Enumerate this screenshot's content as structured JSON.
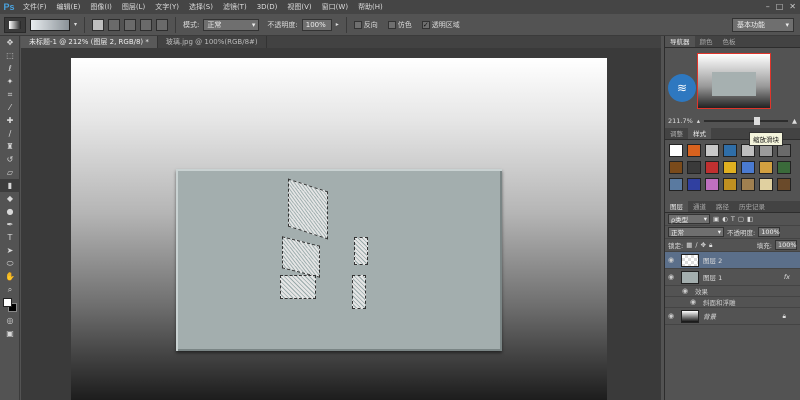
{
  "app": {
    "logo": "Ps",
    "menu": [
      "文件(F)",
      "编辑(E)",
      "图像(I)",
      "图层(L)",
      "文字(Y)",
      "选择(S)",
      "滤镜(T)",
      "3D(D)",
      "视图(V)",
      "窗口(W)",
      "帮助(H)"
    ],
    "window_controls": [
      "–",
      "□",
      "✕"
    ]
  },
  "options": {
    "mode_label": "模式:",
    "mode_value": "正常",
    "opacity_label": "不透明度:",
    "opacity_value": "100%",
    "reverse_label": "反向",
    "dither_label": "仿色",
    "transparency_label": "透明区域",
    "workspace": "基本功能"
  },
  "documents": {
    "tabs": [
      "未标题-1 @ 212% (图层 2, RGB/8) *",
      "玻璃.jpg @ 100%(RGB/8#)"
    ]
  },
  "navigator": {
    "tabs": [
      "导航器",
      "颜色",
      "色板"
    ],
    "zoom": "211.7%",
    "zoom_fraction": 0.6,
    "tooltip": "缩放滑块"
  },
  "styles_panel": {
    "tabs": [
      "调整",
      "样式"
    ],
    "swatches": [
      "#ffffff",
      "#d8621e",
      "#c9c9c9",
      "#2f6ea8",
      "#bfbfbf",
      "#9a9a9a",
      "#6a6a6a",
      "#7a4a1a",
      "#3a3a3a",
      "#c03030",
      "#e0b020",
      "#4a7ad0",
      "#d2a040",
      "#3a6a3a",
      "#5a7aa0",
      "#3040a0",
      "#c070c0",
      "#c09020",
      "#a08050",
      "#e0d0a0",
      "#6a4a2a"
    ]
  },
  "layers": {
    "tabs": [
      "图层",
      "通道",
      "路径",
      "历史记录"
    ],
    "filter_label": "ρ类型",
    "blend_mode": "正常",
    "opacity_label": "不透明度:",
    "opacity_value": "100%",
    "lock_label": "锁定:",
    "fill_label": "填充:",
    "fill_value": "100%",
    "items": [
      {
        "name": "图层 2",
        "selected": true
      },
      {
        "name": "图层 1",
        "selected": false,
        "fx": "fx"
      },
      {
        "name": "效果",
        "sub": true
      },
      {
        "name": "斜面和浮雕",
        "sub": true
      },
      {
        "name": "背景",
        "selected": false
      }
    ]
  }
}
